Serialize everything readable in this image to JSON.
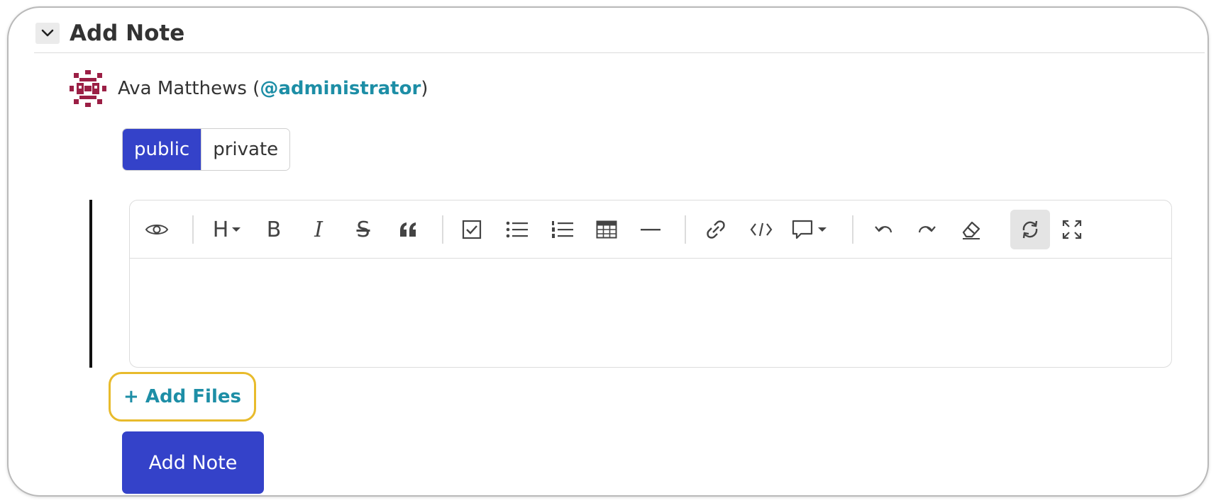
{
  "section": {
    "title": "Add Note"
  },
  "author": {
    "name": "Ava Matthews",
    "open_paren": " (",
    "handle": "@administrator",
    "close_paren": ")"
  },
  "visibility": {
    "options": [
      "public",
      "private"
    ],
    "selected": "public"
  },
  "toolbar": {
    "buttons": [
      "eye-icon",
      "heading-icon",
      "bold-icon",
      "italic-icon",
      "strikethrough-icon",
      "quote-icon",
      "task-list-icon",
      "bullet-list-icon",
      "ordered-list-icon",
      "table-icon",
      "horizontal-rule-icon",
      "link-icon",
      "code-icon",
      "comment-icon",
      "undo-icon",
      "redo-icon",
      "eraser-icon",
      "sync-icon",
      "fullscreen-icon"
    ],
    "heading_glyph": "H",
    "bold_glyph": "B",
    "italic_glyph": "I",
    "strike_glyph": "S"
  },
  "editor": {
    "value": ""
  },
  "add_files_label": "+ Add Files",
  "submit_label": "Add Note",
  "colors": {
    "primary": "#3442c9",
    "link": "#1d8ea6",
    "highlight": "#e8bb2c",
    "avatar": "#9b1f45"
  }
}
